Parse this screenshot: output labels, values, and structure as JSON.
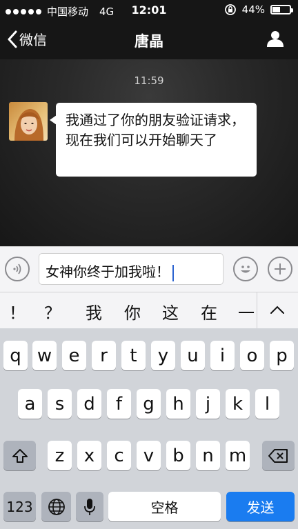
{
  "status_bar": {
    "carrier": "中国移动",
    "network": "4G",
    "time": "12:01",
    "battery": "44%",
    "battery_level": 0.44
  },
  "navbar": {
    "back_label": "微信",
    "title": "唐晶"
  },
  "chat": {
    "timestamp": "11:59",
    "messages": [
      {
        "sender": "contact",
        "text": "我通过了你的朋友验证请求，现在我们可以开始聊天了"
      }
    ]
  },
  "input": {
    "value": "女神你终于加我啦！"
  },
  "suggestions": [
    "！",
    "？",
    "我",
    "你",
    "这",
    "在",
    "一"
  ],
  "keyboard": {
    "row1": [
      "q",
      "w",
      "e",
      "r",
      "t",
      "y",
      "u",
      "i",
      "o",
      "p"
    ],
    "row2": [
      "a",
      "s",
      "d",
      "f",
      "g",
      "h",
      "j",
      "k",
      "l"
    ],
    "row3": [
      "z",
      "x",
      "c",
      "v",
      "b",
      "n",
      "m"
    ],
    "numbers_label": "123",
    "space_label": "空格",
    "send_label": "发送"
  },
  "colors": {
    "send_button": "#1a7cf0",
    "keyboard_bg": "#d1d4d9"
  },
  "icons": [
    "signal-dots-icon",
    "lock-rotation-icon",
    "battery-icon",
    "back-chevron-icon",
    "profile-icon",
    "voice-icon",
    "emoji-icon",
    "plus-icon",
    "collapse-chevron-icon",
    "shift-icon",
    "backspace-icon",
    "globe-icon",
    "microphone-icon"
  ]
}
